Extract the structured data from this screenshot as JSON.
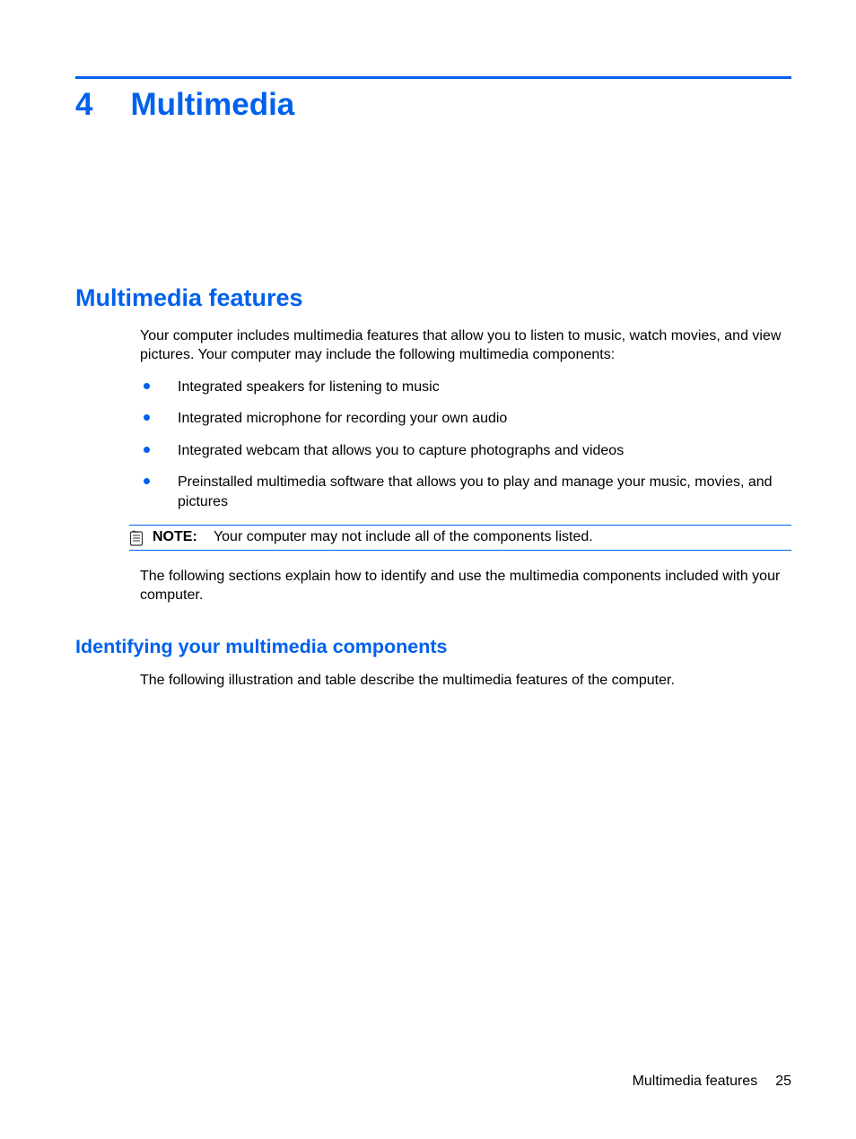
{
  "chapter": {
    "number": "4",
    "title": "Multimedia"
  },
  "section": {
    "heading": "Multimedia features",
    "intro": "Your computer includes multimedia features that allow you to listen to music, watch movies, and view pictures. Your computer may include the following multimedia components:",
    "bullets": [
      "Integrated speakers for listening to music",
      "Integrated microphone for recording your own audio",
      "Integrated webcam that allows you to capture photographs and videos",
      "Preinstalled multimedia software that allows you to play and manage your music, movies, and pictures"
    ],
    "note_label": "NOTE:",
    "note_text": "Your computer may not include all of the components listed.",
    "after_note": "The following sections explain how to identify and use the multimedia components included with your computer."
  },
  "subsection": {
    "heading": "Identifying your multimedia components",
    "body": "The following illustration and table describe the multimedia features of the computer."
  },
  "footer": {
    "section_name": "Multimedia features",
    "page_number": "25"
  }
}
